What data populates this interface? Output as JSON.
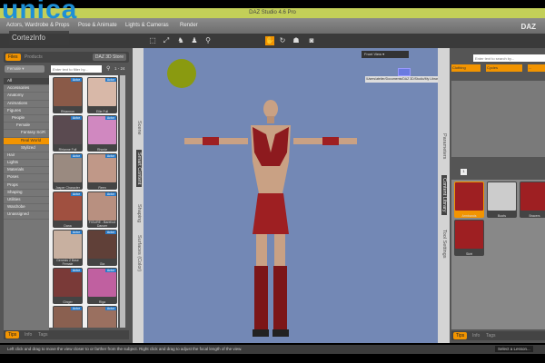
{
  "watermark": {
    "brand": "unica",
    "sub": "CortezInfo"
  },
  "window": {
    "title": "DAZ Studio 4.6 Pro",
    "logo": "DAZ"
  },
  "menu": {
    "tabs": [
      "Actors, Wardrobe & Props",
      "Pose & Animate",
      "Lights & Cameras",
      "Render"
    ]
  },
  "left_panel": {
    "tabs": [
      "Files",
      "Products"
    ],
    "store_button": "DAZ 3D Store",
    "filter_dropdown": "Female",
    "search_placeholder": "Enter text to filter by...",
    "page_range": "1 - 24",
    "categories": [
      "All",
      "Accessories",
      "Anatomy",
      "Animations",
      "Figures",
      "People",
      "Female",
      "Fantasy SciFi",
      "Real World",
      "Stylized",
      "Hair",
      "Lights",
      "Materials",
      "Poses",
      "Props",
      "Shaping",
      "Utilities",
      "Wardrobe",
      "Unassigned"
    ],
    "items": [
      {
        "name": "Rhiannon",
        "badge": "Actor"
      },
      {
        "name": "Ellie Full",
        "badge": "Actor"
      },
      {
        "name": "Rhianne Full",
        "badge": "Actor"
      },
      {
        "name": "Rhonie",
        "badge": "Actor"
      },
      {
        "name": "Jasper Character",
        "badge": "Actor"
      },
      {
        "name": "Reen",
        "badge": "Actor"
      },
      {
        "name": "Dana",
        "badge": "Actor"
      },
      {
        "name": "FIGURE - Barefoot Dancer",
        "badge": "Actor"
      },
      {
        "name": "Genesis 2 Base Female",
        "badge": "Actor"
      },
      {
        "name": "Gia",
        "badge": "Actor"
      },
      {
        "name": "Ginger",
        "badge": "Actor"
      },
      {
        "name": "Riga",
        "badge": "Actor"
      },
      {
        "name": "",
        "badge": "Actor"
      },
      {
        "name": "",
        "badge": "Actor"
      }
    ],
    "bottom_tabs": [
      "Tips",
      "Info",
      "Tags"
    ]
  },
  "left_vtabs": [
    "Scene",
    "Smart Content",
    "Shaping",
    "Surfaces (Color)"
  ],
  "viewport": {
    "view_dropdown": "Front View",
    "tooltip_path": "/Users/atelier/Documents/DAZ 3D/Studio/My Library/People/Genesis 2 Female/Clothing/Cyberlingo Armor - ..."
  },
  "right_vtabs": [
    "Parameters",
    "Content Library",
    "Tool Settings"
  ],
  "right_panel": {
    "search_placeholder": "Enter text to search by...",
    "filters": [
      "Clothing",
      "Cycles",
      "..."
    ],
    "page": "1",
    "items": [
      "Armbands",
      "Boots",
      "Bracers",
      "Skirt"
    ],
    "bottom_tabs": [
      "Tips",
      "Info",
      "Tags"
    ]
  },
  "status": {
    "message": "Left click and drag to move the view closer to or farther from the subject. Right click and drag to adjust the focal length of the view.",
    "lesson_button": "Select a Lesson..."
  },
  "colors": {
    "accent": "#f29400",
    "viewport": "#7388b5",
    "title_bar": "#c3cf58"
  }
}
